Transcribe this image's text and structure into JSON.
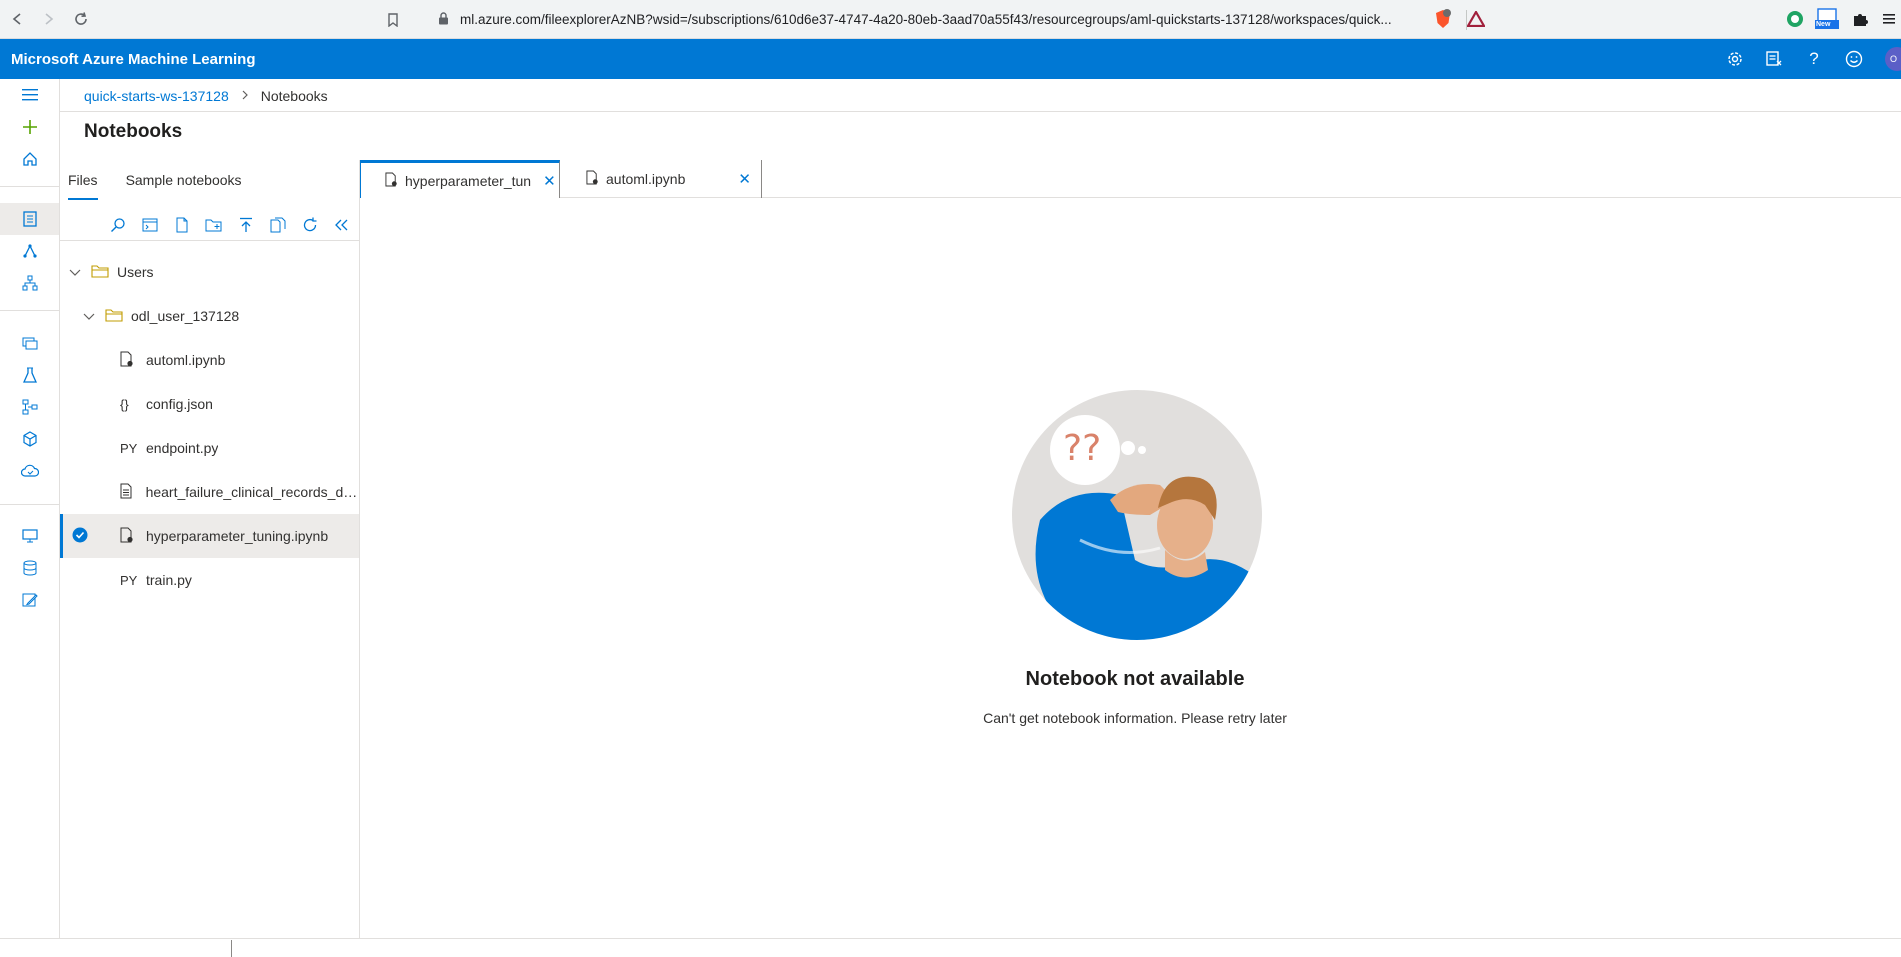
{
  "browser": {
    "url": "ml.azure.com/fileexplorerAzNB?wsid=/subscriptions/610d6e37-4747-4a20-80eb-3aad70a55f43/resourcegroups/aml-quickstarts-137128/workspaces/quick...",
    "new_badge": "New",
    "avatar_initials": "O"
  },
  "header": {
    "app_title": "Microsoft Azure Machine Learning"
  },
  "breadcrumb": {
    "workspace": "quick-starts-ws-137128",
    "current": "Notebooks"
  },
  "page": {
    "title": "Notebooks"
  },
  "file_panel": {
    "tabs": [
      {
        "label": "Files",
        "active": true
      },
      {
        "label": "Sample notebooks",
        "active": false
      }
    ],
    "tree": [
      {
        "name": "Users",
        "type": "folder",
        "expanded": true,
        "level": 0
      },
      {
        "name": "odl_user_137128",
        "type": "folder",
        "expanded": true,
        "level": 1
      },
      {
        "name": "automl.ipynb",
        "type": "notebook",
        "level": 2
      },
      {
        "name": "config.json",
        "type": "json",
        "badge": "{}",
        "level": 2
      },
      {
        "name": "endpoint.py",
        "type": "python",
        "badge": "PY",
        "level": 2
      },
      {
        "name": "heart_failure_clinical_records_da...",
        "type": "file",
        "level": 2
      },
      {
        "name": "hyperparameter_tuning.ipynb",
        "type": "notebook",
        "level": 2,
        "selected": true
      },
      {
        "name": "train.py",
        "type": "python",
        "badge": "PY",
        "level": 2
      }
    ]
  },
  "editor": {
    "tabs": [
      {
        "label": "hyperparameter_tun",
        "active": true
      },
      {
        "label": "automl.ipynb",
        "active": false
      }
    ],
    "empty_title": "Notebook not available",
    "empty_message": "Can't get notebook information. Please retry later",
    "illustration_text": "??"
  },
  "colors": {
    "brand": "#0078d4",
    "selected_bg": "#edebe9"
  }
}
